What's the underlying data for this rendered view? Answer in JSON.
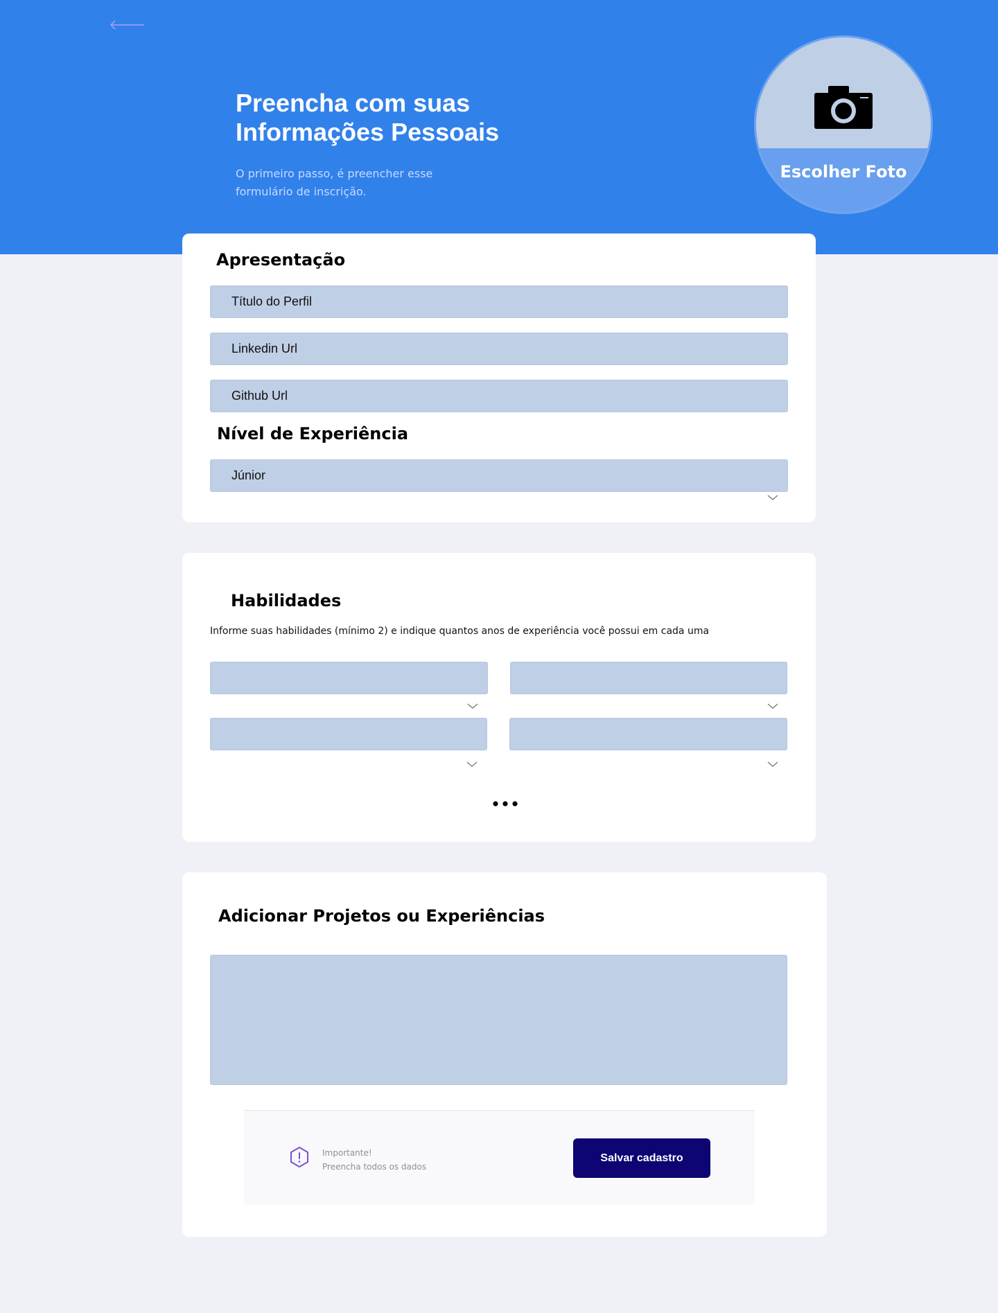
{
  "header": {
    "title": "Preencha com suas\nInformações Pessoais",
    "subtitle": "O primeiro passo, é preencher esse formulário de inscrição.",
    "photo_label": "Escolher Foto",
    "background_color": "#3181eb"
  },
  "apresentacao": {
    "title": "Apresentação",
    "fields": [
      {
        "placeholder": "Título do Perfil"
      },
      {
        "placeholder": "Linkedin Url"
      },
      {
        "placeholder": "Github Url"
      }
    ]
  },
  "nivel": {
    "title": "Nível de Experiência",
    "selected": "Júnior"
  },
  "habilidades": {
    "title": "Habilidades",
    "description": "Informe suas habilidades (mínimo 2) e indique quantos anos de experiência você possui em cada uma",
    "selects": [
      "",
      "",
      "",
      ""
    ]
  },
  "projetos": {
    "title": "Adicionar Projetos ou Experiências",
    "value": ""
  },
  "footer": {
    "warning_title": "Importante!",
    "warning_text": "Preencha todos os dados",
    "save_label": "Salvar cadastro",
    "save_color": "#0c0573"
  },
  "colors": {
    "field_bg": "#bfcfe6",
    "page_bg": "#f0f1f7",
    "warning_accent": "#7b4fd6"
  }
}
